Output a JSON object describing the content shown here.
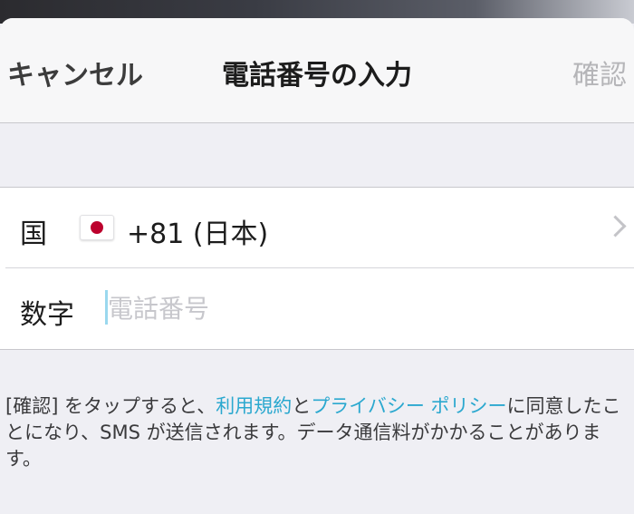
{
  "navbar": {
    "cancel_label": "キャンセル",
    "title": "電話番号の入力",
    "confirm_label": "確認"
  },
  "form": {
    "country": {
      "label": "国",
      "flag_icon": "japan-flag-icon",
      "value": "+81 (日本)"
    },
    "phone": {
      "label": "数字",
      "value": "",
      "placeholder": "電話番号"
    }
  },
  "notice": {
    "text_before": "[確認] をタップすると、",
    "terms_link": "利用規約",
    "text_middle": "と",
    "privacy_link": "プライバシー ポリシー",
    "text_after": "に同意したことになり、SMS が送信されます。データ通信料がかかることがあります。"
  },
  "colors": {
    "link": "#2ba8cf",
    "flag_red": "#bc002d",
    "confirm_disabled": "#b5b5b8",
    "background": "#efeff4"
  }
}
